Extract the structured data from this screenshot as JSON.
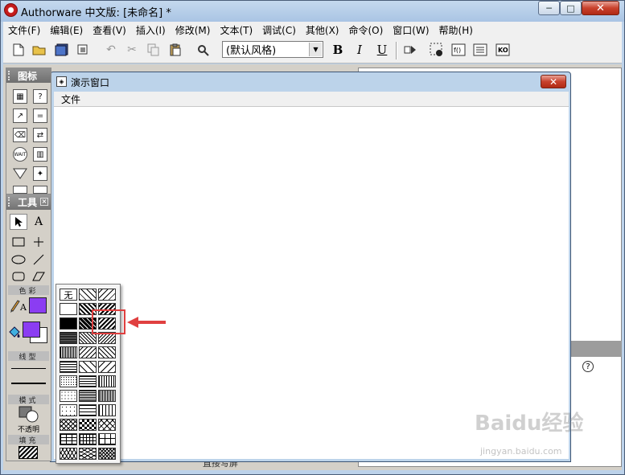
{
  "app": {
    "title": "Authorware 中文版: [未命名] *",
    "min_label": "─",
    "max_label": "□",
    "close_label": "✕"
  },
  "menubar": {
    "items": [
      "文件(F)",
      "编辑(E)",
      "查看(V)",
      "插入(I)",
      "修改(M)",
      "文本(T)",
      "调试(C)",
      "其他(X)",
      "命令(O)",
      "窗口(W)",
      "帮助(H)"
    ]
  },
  "toolbar": {
    "style_value": "(默认风格)",
    "bold_label": "B",
    "italic_label": "I",
    "underline_label": "U"
  },
  "icon_palette": {
    "title": "图标"
  },
  "presentation_window": {
    "title": "演示窗口",
    "menu_file": "文件",
    "close_label": "✕"
  },
  "tool_palette": {
    "title": "工具",
    "text_tool": "A",
    "color_section": "色彩",
    "line_section": "线型",
    "mode_section": "模式",
    "mode_value": "不透明",
    "fill_section": "填充",
    "colors": {
      "fill_foreground": "#8b3df2",
      "text_color": "#8b3df2"
    }
  },
  "fill_popup": {
    "none_label": "无"
  },
  "behind_window": {
    "help_label": "?",
    "partial_text": "直接写屏"
  },
  "watermark": {
    "text": "Baidu经验",
    "sub": "jingyan.baidu.com"
  }
}
